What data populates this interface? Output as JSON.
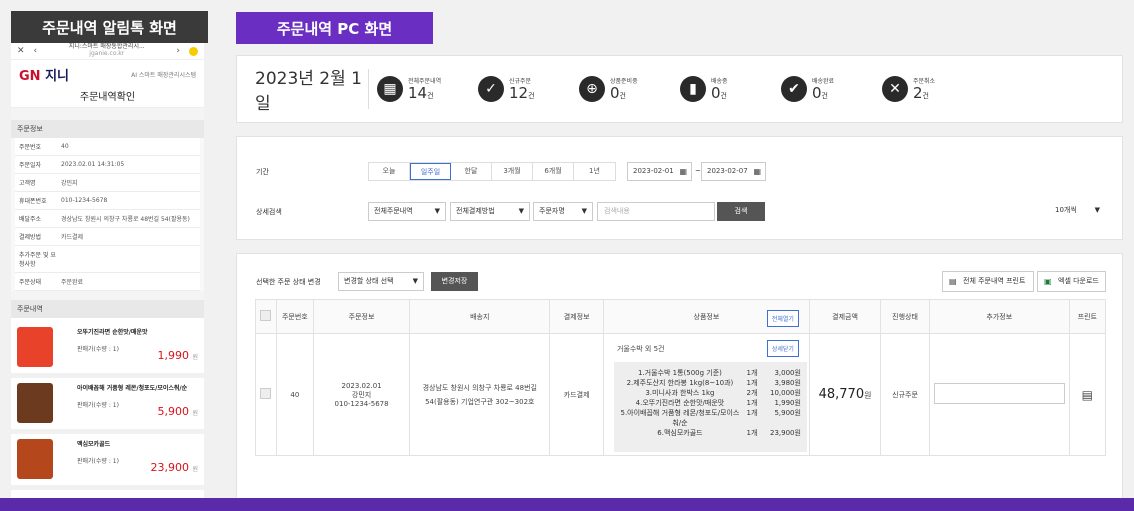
{
  "tags": {
    "left": "주문내역 알림톡 화면",
    "right": "주문내역 PC 화면"
  },
  "phone": {
    "url_line1": "지니:스마트 매장통합관리시...",
    "url_line2": "jganie.co.kr",
    "logo_mark": "GN",
    "logo_text": "지니",
    "subtitle": "AI 스마트 매장관리시스템",
    "title": "주문내역확인",
    "section_order_info": "주문정보",
    "info_rows": [
      {
        "k": "주문번호",
        "v": "40"
      },
      {
        "k": "주문일자",
        "v": "2023.02.01 14:31:05"
      },
      {
        "k": "고객명",
        "v": "강민지"
      },
      {
        "k": "휴대폰번호",
        "v": "010-1234-5678"
      },
      {
        "k": "배달주소",
        "v": "경상남도 창원시 의창구 차룡로 48번길 54(팔용동)"
      },
      {
        "k": "결제방법",
        "v": "카드결제"
      },
      {
        "k": "추가주문 및 요청사항",
        "v": ""
      },
      {
        "k": "주문상태",
        "v": "주문완료"
      }
    ],
    "section_order_list": "주문내역",
    "items": [
      {
        "name": "오뚜기진라면 순한맛/매운맛",
        "qty": "판매가(수량 : 1)",
        "price": "1,990",
        "unit": "원",
        "color": "#e8432a"
      },
      {
        "name": "아이배꼽해 거품형 레몬/청포도/모이스춰/순",
        "qty": "판매가(수량 : 1)",
        "price": "5,900",
        "unit": "원",
        "color": "#6b3a1f"
      },
      {
        "name": "맥심모카골드",
        "qty": "판매가(수량 : 1)",
        "price": "23,900",
        "unit": "원",
        "color": "#b5471c"
      }
    ]
  },
  "stats": {
    "date": "2023년 2월 1일",
    "items": [
      {
        "label": "전체주문내역",
        "value": "14",
        "unit": "건",
        "icon": "grid-icon",
        "glyph": "▦"
      },
      {
        "label": "신규주문",
        "value": "12",
        "unit": "건",
        "icon": "check-icon",
        "glyph": "✓"
      },
      {
        "label": "상품준비중",
        "value": "0",
        "unit": "건",
        "icon": "cart-icon",
        "glyph": "⊕"
      },
      {
        "label": "배송중",
        "value": "0",
        "unit": "건",
        "icon": "truck-icon",
        "glyph": "▮"
      },
      {
        "label": "배송완료",
        "value": "0",
        "unit": "건",
        "icon": "check-double-icon",
        "glyph": "✔"
      },
      {
        "label": "주문취소",
        "value": "2",
        "unit": "건",
        "icon": "cancel-icon",
        "glyph": "✕"
      }
    ]
  },
  "filter": {
    "period_label": "기간",
    "periods": [
      "오늘",
      "일주일",
      "한달",
      "3개월",
      "6개월",
      "1년"
    ],
    "active_period": "일주일",
    "date_from": "2023-02-01",
    "date_sep": "~",
    "date_to": "2023-02-07",
    "detail_label": "상세검색",
    "sel_order": "전체주문내역",
    "sel_pay": "전체결제방법",
    "sel_field": "주문자명",
    "search_placeholder": "검색내용",
    "search_btn": "검색",
    "page_size": "10개씩"
  },
  "list": {
    "change_label": "선택한 주문 상태 변경",
    "change_select": "변경할 상태 선택",
    "change_btn": "변경저장",
    "print_all": "전체 주문내역 프린트",
    "excel": "엑셀 다운로드",
    "headers": [
      "주문번호",
      "주문정보",
      "배송지",
      "결제정보",
      "상품정보",
      "결제금액",
      "진행상태",
      "추가정보",
      "프린트"
    ],
    "expand_all": "전체열기",
    "row": {
      "no": "40",
      "date": "2023.02.01",
      "name": "강민지",
      "phone": "010-1234-5678",
      "addr": "경상남도 창원시 의창구 차룡로 48번길 54(팔용동) 기업연구관 302~302호",
      "pay": "카드결제",
      "summary": "거울수박 외 5건",
      "detail_btn": "상세닫기",
      "products": [
        {
          "n": "1.거울수박 1통(500g 기준)",
          "q": "1개",
          "p": "3,000원"
        },
        {
          "n": "2.제주도산지 한라봉 1kg(8~10과)",
          "q": "1개",
          "p": "3,980원"
        },
        {
          "n": "3.미니사과 한박스 1kg",
          "q": "2개",
          "p": "10,000원"
        },
        {
          "n": "4.오뚜기진라면 순한맛/매운맛",
          "q": "1개",
          "p": "1,990원"
        },
        {
          "n": "5.아이배꼽해 거품형 레몬/청포도/모이스춰/순",
          "q": "1개",
          "p": "5,900원"
        },
        {
          "n": "6.맥심모카골드",
          "q": "1개",
          "p": "23,900원"
        }
      ],
      "amount": "48,770",
      "amount_unit": "원",
      "status": "신규주문"
    }
  }
}
